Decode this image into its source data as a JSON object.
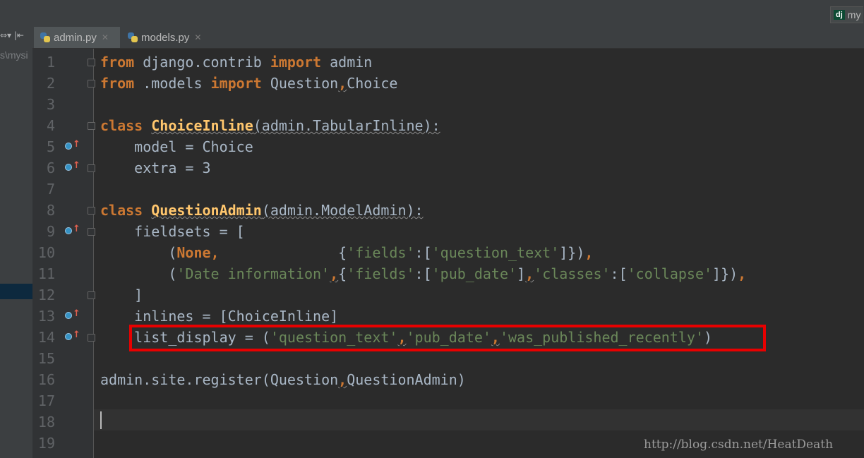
{
  "project_badge": {
    "icon": "dj",
    "label": "my"
  },
  "left_panel": {
    "toolbar_icons": "⇔▾ |⇤",
    "path_fragment": "s\\mysi"
  },
  "tabs": [
    {
      "name": "admin.py",
      "active": true
    },
    {
      "name": "models.py",
      "active": false
    }
  ],
  "editor": {
    "line_numbers": [
      "1",
      "2",
      "3",
      "4",
      "5",
      "6",
      "7",
      "8",
      "9",
      "10",
      "11",
      "12",
      "13",
      "14",
      "15",
      "16",
      "17",
      "18",
      "19"
    ],
    "lines": {
      "l1": {
        "kw1": "from",
        "t1": " django.contrib ",
        "kw2": "import",
        "t2": " admin"
      },
      "l2": {
        "kw1": "from",
        "t1": " .models ",
        "kw2": "import",
        "t2": " Question",
        "sep": ",",
        "t3": "Choice"
      },
      "l4": {
        "kw": "class",
        "sp": " ",
        "name": "ChoiceInline",
        "rest": "(admin.TabularInline):"
      },
      "l5": {
        "text": "    model = Choice"
      },
      "l6": {
        "text": "    extra = 3"
      },
      "l8": {
        "kw": "class",
        "sp": " ",
        "name": "QuestionAdmin",
        "rest": "(admin.ModelAdmin):"
      },
      "l9": {
        "text": "    fieldsets = ["
      },
      "l10": {
        "indent": "        (",
        "none": "None",
        "comma": ",",
        "pad": "              {",
        "s1": "'fields'",
        "colon": ":[",
        "s2": "'question_text'",
        "close": "]})",
        "trail": ","
      },
      "l11": {
        "indent": "        (",
        "s1": "'Date information'",
        "c1": ",",
        "b1": "{",
        "s2": "'fields'",
        "colon1": ":[",
        "s3": "'pub_date'",
        "b2": "]",
        "c2": ",",
        "s4": "'classes'",
        "colon2": ":[",
        "s5": "'collapse'",
        "close": "]})",
        "trail": ","
      },
      "l12": {
        "text": "    ]"
      },
      "l13": {
        "text": "    inlines = [ChoiceInline]"
      },
      "l14": {
        "pre": "    list_display = (",
        "s1": "'question_text'",
        "c1": ",",
        "s2": "'pub_date'",
        "c2": ",",
        "s3": "'was_published_recently'",
        "close": ")"
      },
      "l16": {
        "t1": "admin.site.register(Question",
        "sep": ",",
        "t2": "QuestionAdmin)"
      }
    }
  },
  "watermark": "http://blog.csdn.net/HeatDeath"
}
